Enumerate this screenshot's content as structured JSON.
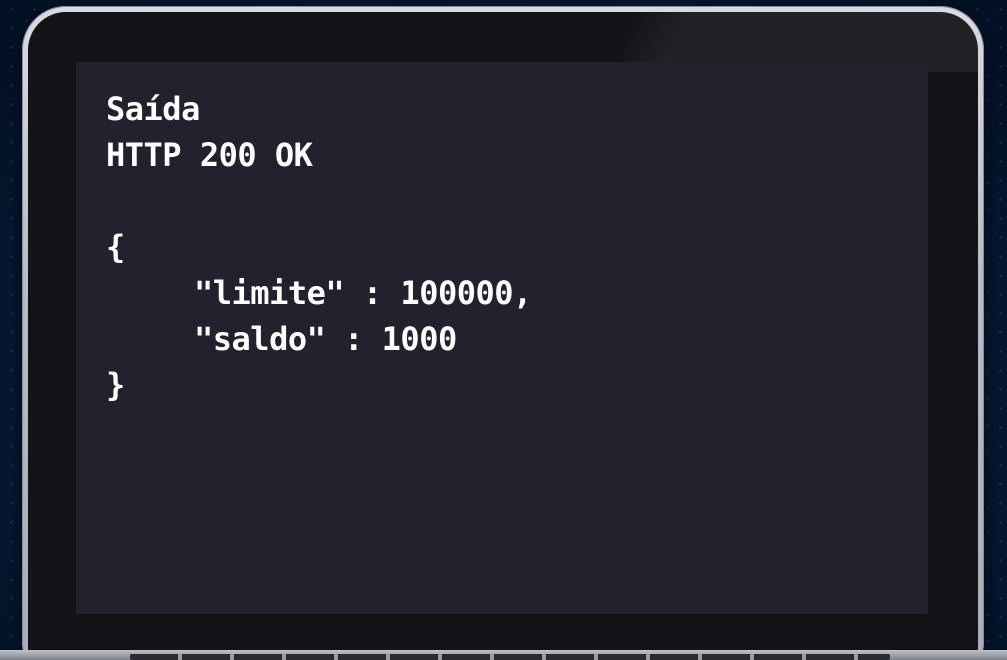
{
  "window": {
    "title": "Saída"
  },
  "response": {
    "status_line": "HTTP 200 OK",
    "open_brace": "{",
    "fields": [
      {
        "line": "\"limite\" : 100000,"
      },
      {
        "line": "\"saldo\" : 1000"
      }
    ],
    "close_brace": "}"
  },
  "colors": {
    "screen_background": "#22212d",
    "text": "#ffffff",
    "bezel": "#141418",
    "frame": "#c4c6cc",
    "backdrop": "#061a36"
  }
}
